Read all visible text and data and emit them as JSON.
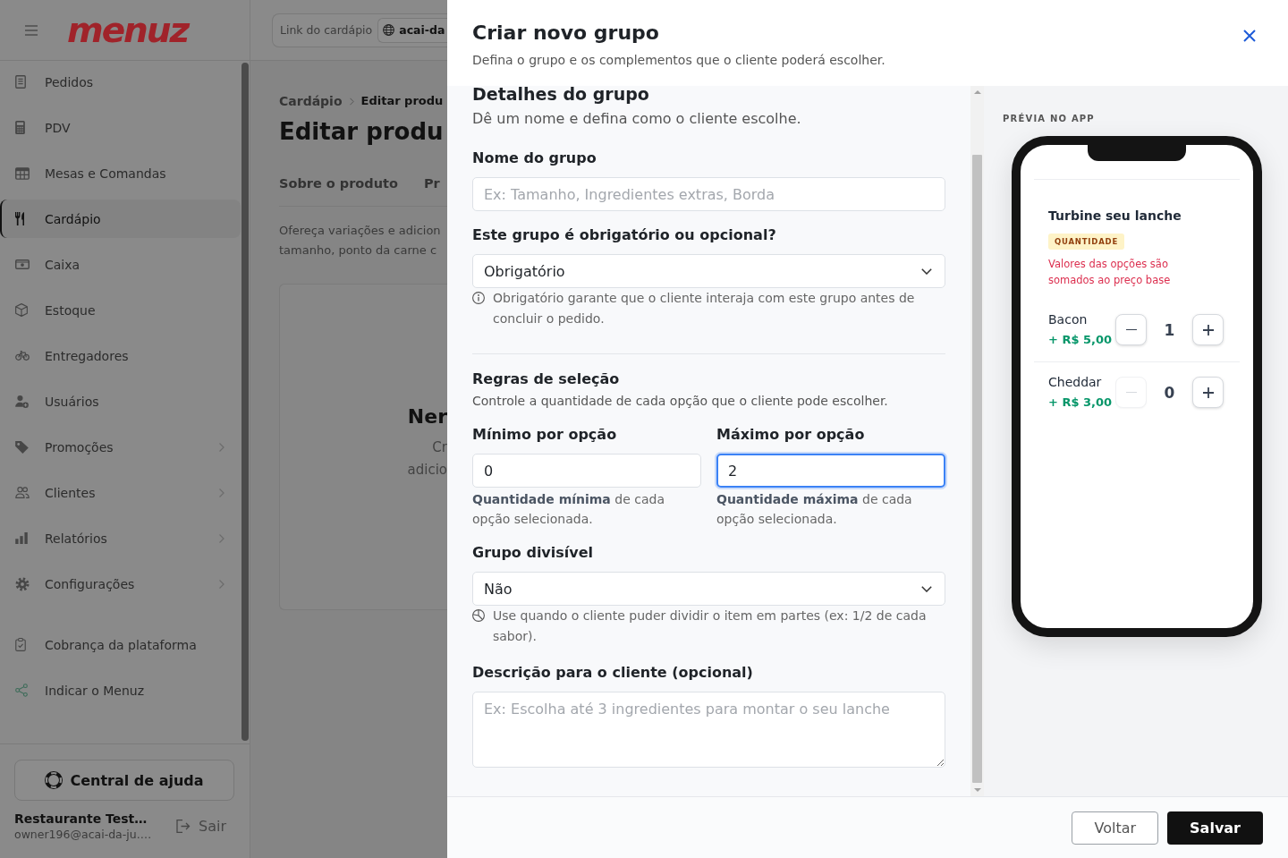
{
  "sidebar": {
    "logo": "menuz",
    "nav_items": [
      {
        "label": "Pedidos",
        "selected": false,
        "submenu": false
      },
      {
        "label": "PDV",
        "selected": false,
        "submenu": false
      },
      {
        "label": "Mesas e Comandas",
        "selected": false,
        "submenu": false
      },
      {
        "label": "Cardápio",
        "selected": true,
        "submenu": false
      },
      {
        "label": "Caixa",
        "selected": false,
        "submenu": false
      },
      {
        "label": "Estoque",
        "selected": false,
        "submenu": false
      },
      {
        "label": "Entregadores",
        "selected": false,
        "submenu": false
      },
      {
        "label": "Usuários",
        "selected": false,
        "submenu": false
      },
      {
        "label": "Promoções",
        "selected": false,
        "submenu": true
      },
      {
        "label": "Clientes",
        "selected": false,
        "submenu": true
      },
      {
        "label": "Relatórios",
        "selected": false,
        "submenu": true
      },
      {
        "label": "Configurações",
        "selected": false,
        "submenu": true
      }
    ],
    "extra_items": [
      {
        "label": "Cobrança da plataforma",
        "selected": false
      },
      {
        "label": "Indicar o Menuz",
        "selected": false
      }
    ],
    "help_button": "Central de ajuda",
    "user": {
      "name": "Restaurante Test…",
      "email": "owner196@acai-da-ju.…"
    },
    "logout_button": "Sair"
  },
  "page": {
    "menu_link": {
      "label": "Link do cardápio",
      "value": "acai-da"
    },
    "breadcrumb": [
      "Cardápio",
      "Editar produ"
    ],
    "title": "Editar produ",
    "tabs": [
      "Sobre o produto",
      "Pr"
    ],
    "intro_lines": [
      "Ofereça variações e adicion",
      "tamanho, ponto da carne c"
    ],
    "empty_state": {
      "title": "Ner",
      "lines": [
        "Cr",
        "adicio"
      ]
    }
  },
  "modal": {
    "title": "Criar novo grupo",
    "subtitle": "Defina o grupo e os complementos que o cliente poderá escolher.",
    "section_title": "Detalhes do grupo",
    "section_subtitle": "Dê um nome e defina como o cliente escolhe.",
    "group_name": {
      "label": "Nome do grupo",
      "placeholder": "Ex: Tamanho, Ingredientes extras, Borda"
    },
    "requirement": {
      "label": "Este grupo é obrigatório ou opcional?",
      "value": "Obrigatório",
      "hint": "Obrigatório garante que o cliente interaja com este grupo antes de concluir o pedido."
    },
    "rules": {
      "title": "Regras de seleção",
      "subtitle": "Controle a quantidade de cada opção que o cliente pode escolher.",
      "limits": [
        {
          "label": "Mínimo por opção",
          "value": "0",
          "focused": false,
          "hint": "**Quantidade mínima** de cada opção selecionada."
        },
        {
          "label": "Máximo por opção",
          "value": "2",
          "focused": true,
          "hint": "**Quantidade máxima** de cada opção selecionada."
        }
      ]
    },
    "divisible": {
      "label": "Grupo divisível",
      "value": "Não",
      "hint": "Use quando o cliente puder dividir o item em partes (ex: 1/2 de cada sabor)."
    },
    "description": {
      "label": "Descrição para o cliente (opcional)",
      "placeholder": "Ex: Escolha até 3 ingredientes para montar o seu lanche"
    },
    "preview": {
      "label": "PRÉVIA NO APP",
      "group_title": "Turbine seu lanche",
      "badge": "QUANTIDADE",
      "note": "Valores das opções são somados ao preço base",
      "options": [
        {
          "name": "Bacon",
          "price": "+ R$ 5,00",
          "quantity": "1",
          "decrease_disabled": false
        },
        {
          "name": "Cheddar",
          "price": "+ R$ 3,00",
          "quantity": "0",
          "decrease_disabled": true
        }
      ]
    },
    "footer_buttons": [
      {
        "label": "Voltar",
        "kind": "secondary"
      },
      {
        "label": "Salvar",
        "kind": "primary"
      }
    ]
  }
}
